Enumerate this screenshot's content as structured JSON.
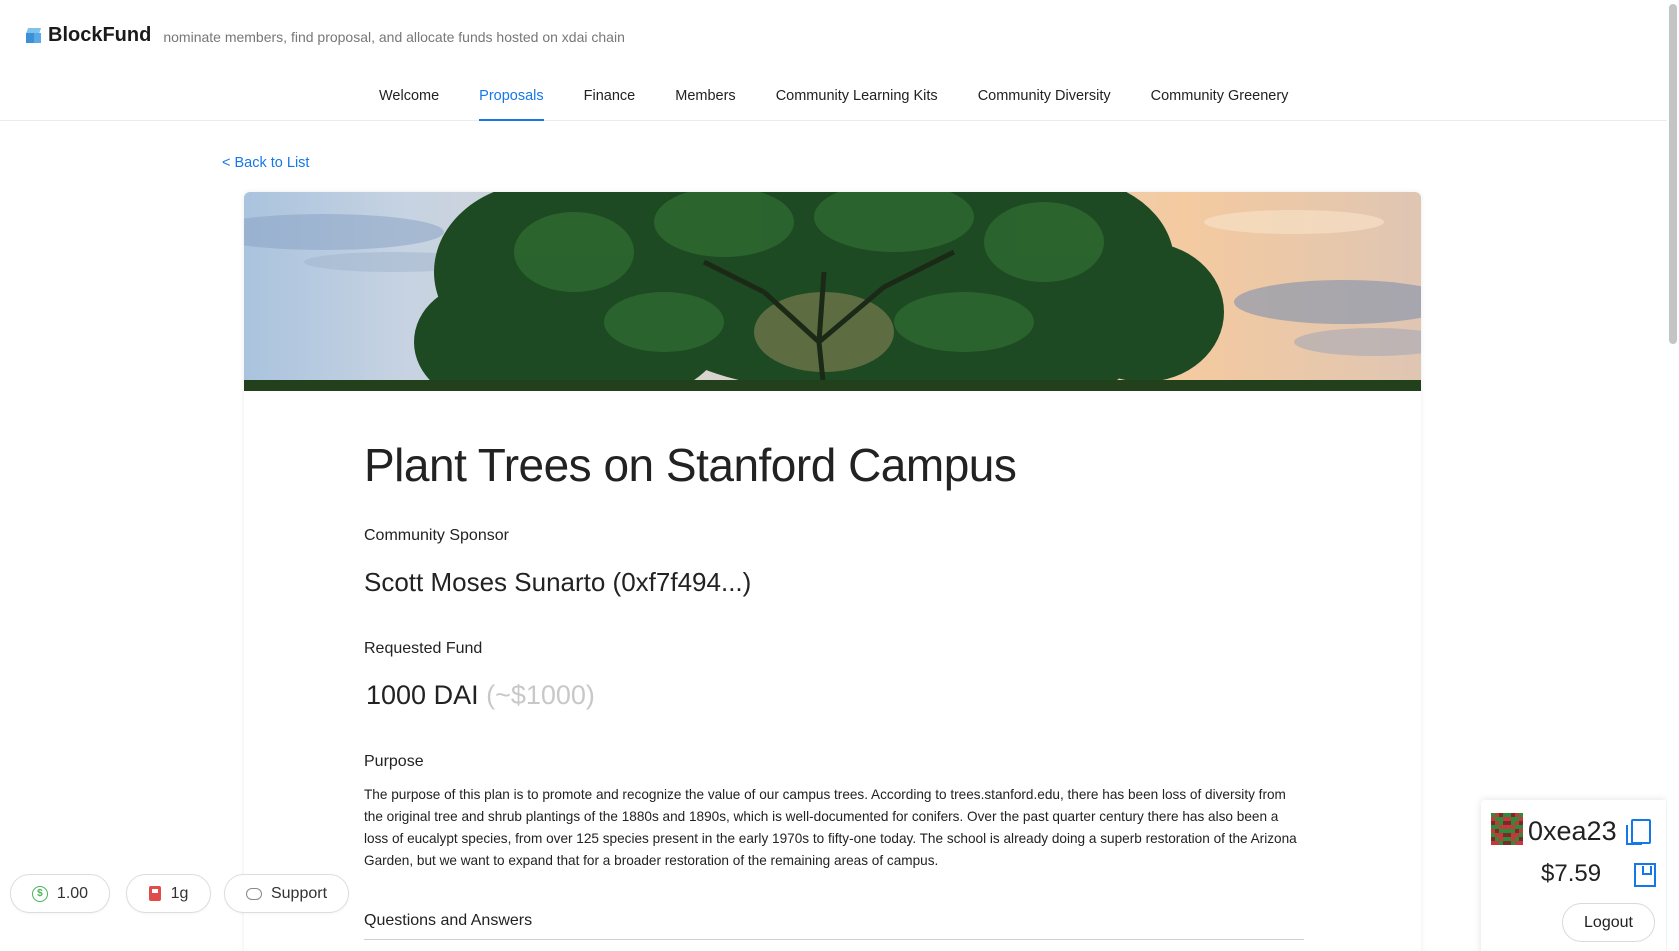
{
  "brand": {
    "name": "BlockFund",
    "tagline": "nominate members, find proposal, and allocate funds hosted on xdai chain",
    "logo_icon": "cube-icon"
  },
  "nav": {
    "items": [
      {
        "label": "Welcome",
        "active": false
      },
      {
        "label": "Proposals",
        "active": true
      },
      {
        "label": "Finance",
        "active": false
      },
      {
        "label": "Members",
        "active": false
      },
      {
        "label": "Community Learning Kits",
        "active": false
      },
      {
        "label": "Community Diversity",
        "active": false
      },
      {
        "label": "Community Greenery",
        "active": false
      }
    ]
  },
  "back_link": "< Back to List",
  "proposal": {
    "banner_image": "tree-sunset-banner",
    "title": "Plant Trees on Stanford Campus",
    "sponsor_label": "Community Sponsor",
    "sponsor_value": "Scott Moses Sunarto (0xf7f494...)",
    "fund_label": "Requested Fund",
    "fund_amount": "1000 DAI",
    "fund_usd": "(~$1000)",
    "purpose_label": "Purpose",
    "purpose_text": "The purpose of this plan is to promote and recognize the value of our campus trees. According to trees.stanford.edu, there has been loss of diversity from the original tree and shrub plantings of the 1880s and 1890s, which is well-documented for conifers. Over the past quarter century there has also been a loss of eucalypt species, from over 125 species present in the early 1970s to fifty-one today. The school is already doing a superb restoration of the Arizona Garden, but we want to expand that for a broader restoration of the remaining areas of campus.",
    "qa_label": "Questions and Answers"
  },
  "footer_pills": {
    "balance": "1.00",
    "gas": "1g",
    "support": "Support"
  },
  "wallet": {
    "address": "0xea23",
    "balance": "$7.59",
    "logout": "Logout"
  },
  "colors": {
    "accent": "#1677e8",
    "text": "#222222",
    "muted": "#c8c8c8"
  }
}
